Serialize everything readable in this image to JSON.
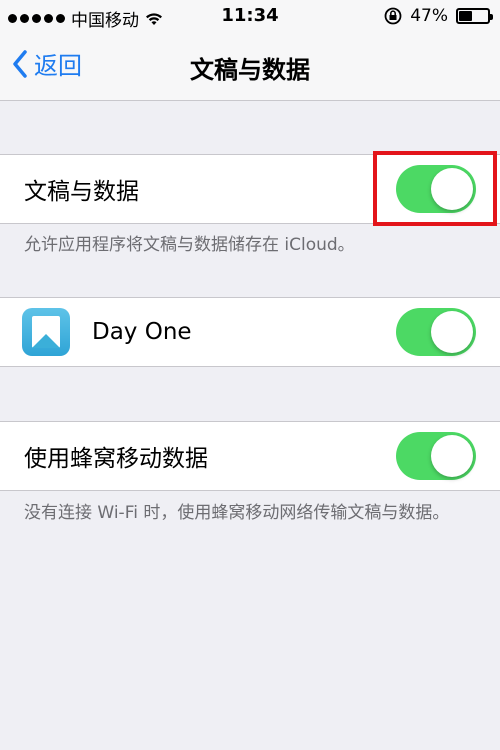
{
  "status_bar": {
    "carrier": "中国移动",
    "time": "11:34",
    "battery": "47%"
  },
  "nav": {
    "back_label": "返回",
    "title": "文稿与数据"
  },
  "settings": {
    "docs_data": {
      "label": "文稿与数据",
      "enabled": true
    },
    "docs_footnote": "允许应用程序将文稿与数据储存在 iCloud。",
    "apps": [
      {
        "label": "Day One",
        "enabled": true
      }
    ],
    "cellular": {
      "label": "使用蜂窝移动数据",
      "enabled": true
    },
    "cellular_footnote": "没有连接 Wi-Fi 时，使用蜂窝移动网络传输文稿与数据。"
  },
  "colors": {
    "toggle_on": "#4cd964",
    "accent": "#1f7cf0",
    "highlight": "#e3141a"
  }
}
